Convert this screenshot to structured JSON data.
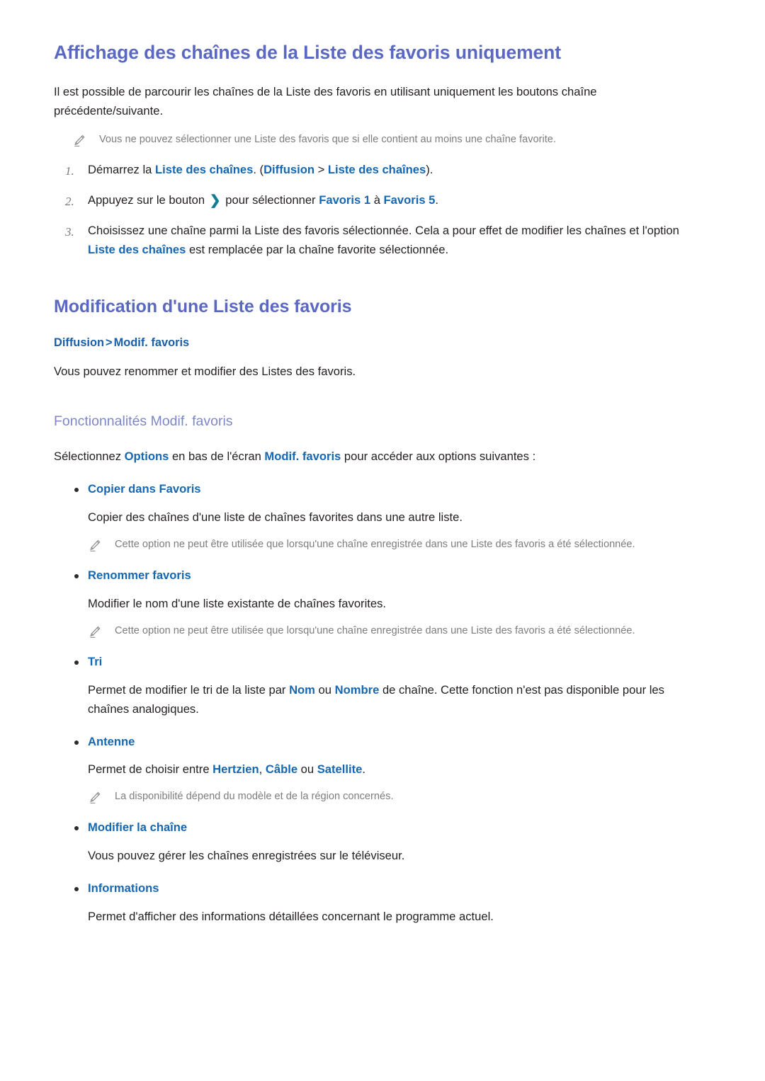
{
  "document": {
    "section1": {
      "heading": "Affichage des chaînes de la Liste des favoris uniquement",
      "intro": "Il est possible de parcourir les chaînes de la Liste des favoris en utilisant uniquement les boutons chaîne précédente/suivante.",
      "note": "Vous ne pouvez sélectionner une Liste des favoris que si elle contient au moins une chaîne favorite.",
      "steps": [
        {
          "number": "1.",
          "parts": [
            {
              "text": "Démarrez la ",
              "style": "plain"
            },
            {
              "text": "Liste des chaînes",
              "style": "link"
            },
            {
              "text": ". (",
              "style": "plain"
            },
            {
              "text": "Diffusion",
              "style": "link"
            },
            {
              "text": " > ",
              "style": "plain"
            },
            {
              "text": "Liste des chaînes",
              "style": "link"
            },
            {
              "text": ").",
              "style": "plain"
            }
          ]
        },
        {
          "number": "2.",
          "parts": [
            {
              "text": "Appuyez sur le bouton ",
              "style": "plain"
            },
            {
              "text": "❯",
              "style": "chevron"
            },
            {
              "text": " pour sélectionner ",
              "style": "plain"
            },
            {
              "text": "Favoris 1",
              "style": "link"
            },
            {
              "text": " à ",
              "style": "plain"
            },
            {
              "text": "Favoris 5",
              "style": "link"
            },
            {
              "text": ".",
              "style": "plain"
            }
          ]
        },
        {
          "number": "3.",
          "parts": [
            {
              "text": "Choisissez une chaîne parmi la Liste des favoris sélectionnée. Cela a pour effet de modifier les chaînes et l'option ",
              "style": "plain"
            },
            {
              "text": "Liste des chaînes",
              "style": "link"
            },
            {
              "text": " est remplacée par la chaîne favorite sélectionnée.",
              "style": "plain"
            }
          ]
        }
      ]
    },
    "section2": {
      "heading": "Modification d'une Liste des favoris",
      "breadcrumb": {
        "first": "Diffusion",
        "separator": ">",
        "second": "Modif. favoris"
      },
      "intro": "Vous pouvez renommer et modifier des Listes des favoris.",
      "subheading": "Fonctionnalités Modif. favoris",
      "lead": [
        {
          "text": "Sélectionnez ",
          "style": "plain"
        },
        {
          "text": "Options",
          "style": "link"
        },
        {
          "text": " en bas de l'écran ",
          "style": "plain"
        },
        {
          "text": "Modif. favoris",
          "style": "link"
        },
        {
          "text": " pour accéder aux options suivantes :",
          "style": "plain"
        }
      ],
      "options": [
        {
          "label": "Copier dans Favoris",
          "description": [
            {
              "text": "Copier des chaînes d'une liste de chaînes favorites dans une autre liste.",
              "style": "plain"
            }
          ],
          "note": "Cette option ne peut être utilisée que lorsqu'une chaîne enregistrée dans une Liste des favoris a été sélectionnée."
        },
        {
          "label": "Renommer favoris",
          "description": [
            {
              "text": "Modifier le nom d'une liste existante de chaînes favorites.",
              "style": "plain"
            }
          ],
          "note": "Cette option ne peut être utilisée que lorsqu'une chaîne enregistrée dans une Liste des favoris a été sélectionnée."
        },
        {
          "label": "Tri",
          "description": [
            {
              "text": "Permet de modifier le tri de la liste par ",
              "style": "plain"
            },
            {
              "text": "Nom",
              "style": "link"
            },
            {
              "text": " ou ",
              "style": "plain"
            },
            {
              "text": "Nombre",
              "style": "link"
            },
            {
              "text": " de chaîne. Cette fonction n'est pas disponible pour les chaînes analogiques.",
              "style": "plain"
            }
          ],
          "note": null
        },
        {
          "label": "Antenne",
          "description": [
            {
              "text": "Permet de choisir entre ",
              "style": "plain"
            },
            {
              "text": "Hertzien",
              "style": "link"
            },
            {
              "text": ", ",
              "style": "plain"
            },
            {
              "text": "Câble",
              "style": "link"
            },
            {
              "text": " ou ",
              "style": "plain"
            },
            {
              "text": "Satellite",
              "style": "link"
            },
            {
              "text": ".",
              "style": "plain"
            }
          ],
          "note": "La disponibilité dépend du modèle et de la région concernés."
        },
        {
          "label": "Modifier la chaîne",
          "description": [
            {
              "text": "Vous pouvez gérer les chaînes enregistrées sur le téléviseur.",
              "style": "plain"
            }
          ],
          "note": null
        },
        {
          "label": "Informations",
          "description": [
            {
              "text": "Permet d'afficher des informations détaillées concernant le programme actuel.",
              "style": "plain"
            }
          ],
          "note": null
        }
      ]
    }
  },
  "colors": {
    "heading_purple": "#5a68c2",
    "subheading_purple": "#7d86c7",
    "link_blue": "#1667b2",
    "breadcrumb_blue": "#1a5fa8",
    "note_gray": "#7d7d7d",
    "chevron_teal": "#127d92",
    "body_text": "#231f20"
  },
  "icons": {
    "note": "pencil-icon",
    "bullet": "bullet-dot-icon",
    "chevron": "chevron-right-icon"
  }
}
